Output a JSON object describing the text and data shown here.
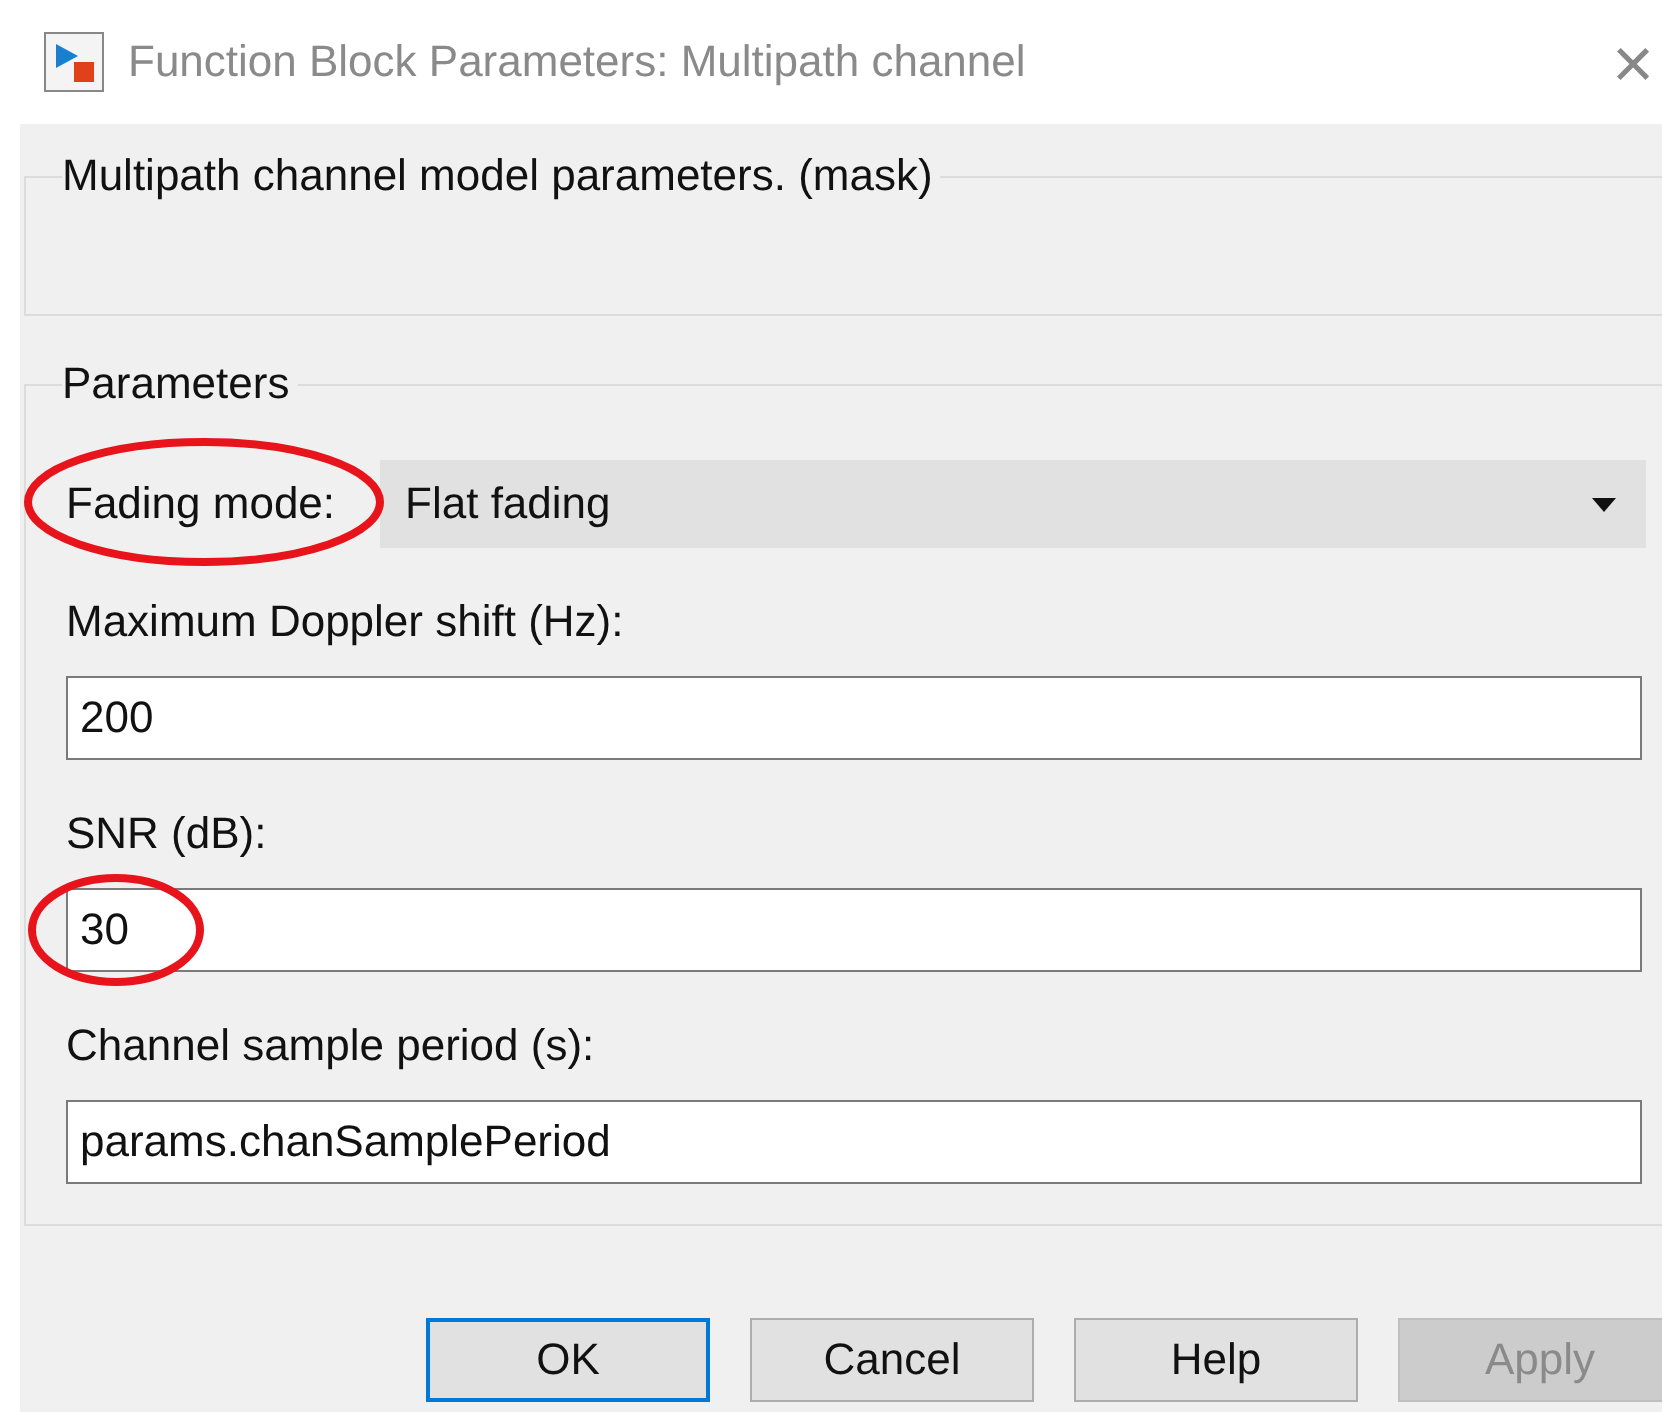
{
  "window": {
    "title": "Function Block Parameters: Multipath channel",
    "close": "×"
  },
  "description_group": {
    "title": "Multipath channel model parameters. (mask)"
  },
  "parameters_group": {
    "title": "Parameters",
    "fields": [
      {
        "kind": "dropdown",
        "label": "Fading mode:",
        "value": "Flat fading",
        "label_circled": true,
        "value_circled": false
      },
      {
        "kind": "text",
        "label": "Maximum Doppler shift (Hz):",
        "value": "200",
        "label_circled": false,
        "value_circled": false
      },
      {
        "kind": "text",
        "label": "SNR (dB):",
        "value": "30",
        "label_circled": false,
        "value_circled": true
      },
      {
        "kind": "text",
        "label": "Channel sample period (s):",
        "value": "params.chanSamplePeriod",
        "label_circled": false,
        "value_circled": false
      }
    ]
  },
  "buttons": [
    {
      "label": "OK",
      "focused": true,
      "disabled": false
    },
    {
      "label": "Cancel",
      "focused": false,
      "disabled": false
    },
    {
      "label": "Help",
      "focused": false,
      "disabled": false
    },
    {
      "label": "Apply",
      "focused": false,
      "disabled": true
    }
  ]
}
